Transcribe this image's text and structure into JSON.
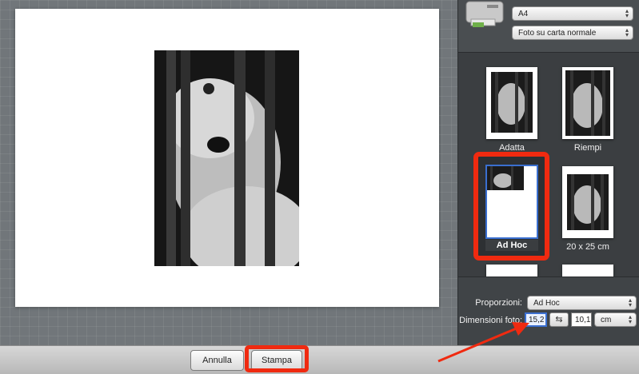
{
  "printer": {
    "paper_size": "A4",
    "paper_type": "Foto su carta normale"
  },
  "layouts": [
    {
      "label": "Adatta"
    },
    {
      "label": "Riempi"
    },
    {
      "label": "Ad Hoc",
      "selected": true
    },
    {
      "label": "20 x 25 cm"
    }
  ],
  "settings": {
    "proportions_label": "Proporzioni:",
    "proportions_value": "Ad Hoc",
    "dimensions_label": "Dimensioni foto:",
    "width_value": "15,2",
    "height_value": "10,1",
    "unit_value": "cm"
  },
  "buttons": {
    "cancel": "Annulla",
    "print": "Stampa"
  },
  "colors": {
    "highlight": "#f02a10",
    "selection_blue": "#3a6fd0"
  }
}
